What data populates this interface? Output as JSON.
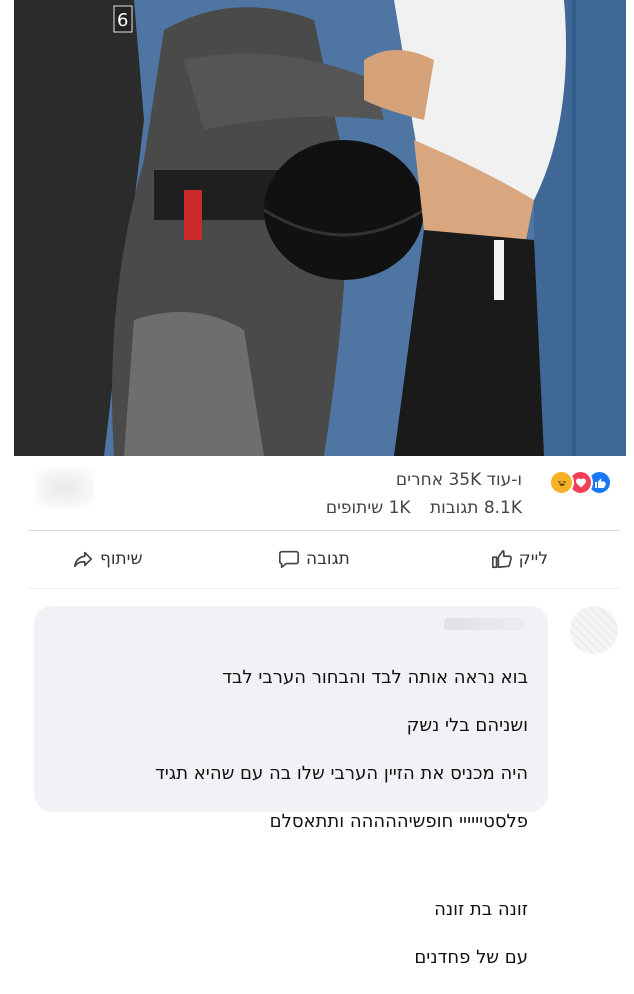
{
  "post": {
    "image_alt": "Police officer grabbing a young man against a blue door",
    "badge_number": "6"
  },
  "reactions": {
    "icons": [
      "like-icon",
      "love-icon",
      "haha-icon"
    ],
    "colors": {
      "like": "#1877f2",
      "love": "#f33e58",
      "haha": "#f7b125"
    },
    "summary": "ו-עוד 35K אחרים"
  },
  "counts": {
    "comments": "8.1K תגובות",
    "shares": "1K שיתופים"
  },
  "actions": {
    "like": "לייק",
    "comment": "תגובה",
    "share": "שיתוף"
  },
  "comment": {
    "lines": [
      "בוא נראה אותה לבד והבחור הערבי לבד",
      "ושניהם בלי נשק",
      "היה מכניס את הזיין הערבי שלו בה עם שהיא תגיד",
      "פלסטיייייי חופשיההההה ותתאסלם"
    ],
    "lines2": [
      "זונה בת זונה",
      "עם של פחדנים"
    ]
  }
}
